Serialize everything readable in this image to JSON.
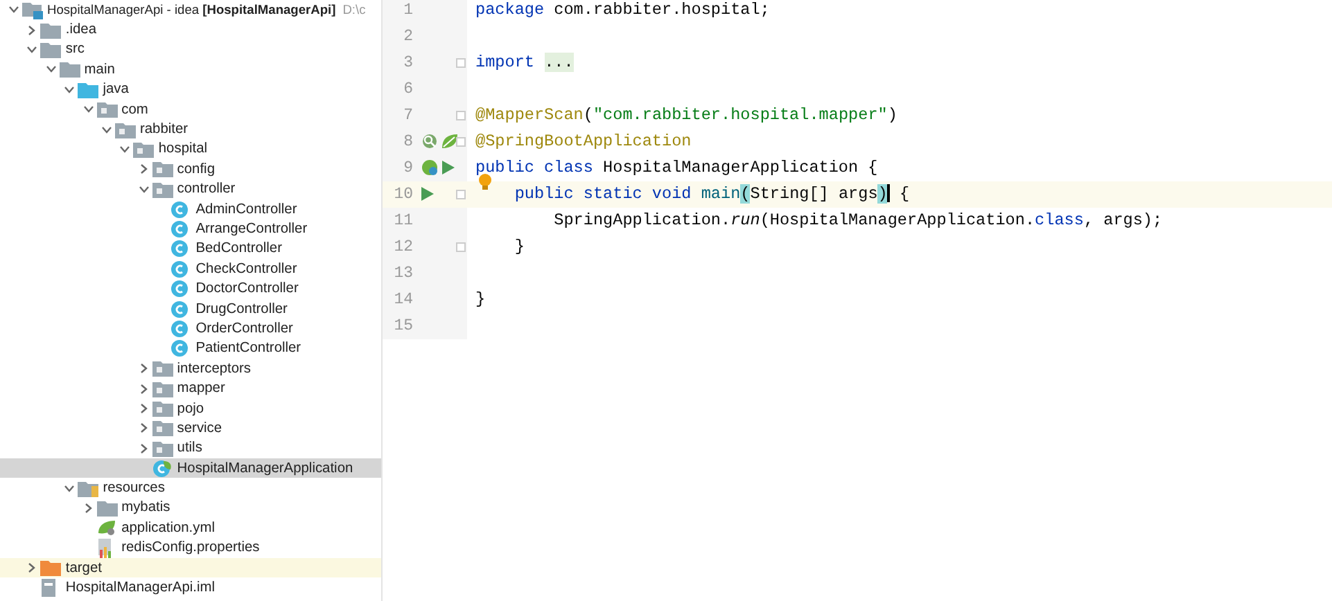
{
  "project_tree": {
    "items": [
      {
        "label": "HospitalManagerApi - idea **[HospitalManagerApi]**",
        "path": "D:\\c",
        "kind": "module",
        "expanded": true,
        "selected": false,
        "children": [
          {
            "label": ".idea",
            "kind": "folder",
            "expanded": false,
            "selected": false
          },
          {
            "label": "src",
            "kind": "folder",
            "expanded": true,
            "selected": false,
            "children": [
              {
                "label": "main",
                "kind": "folder",
                "expanded": true,
                "selected": false,
                "children": [
                  {
                    "label": "java",
                    "kind": "source-folder",
                    "expanded": true,
                    "selected": false,
                    "children": [
                      {
                        "label": "com",
                        "kind": "package",
                        "expanded": true,
                        "selected": false,
                        "children": [
                          {
                            "label": "rabbiter",
                            "kind": "package",
                            "expanded": true,
                            "selected": false,
                            "children": [
                              {
                                "label": "hospital",
                                "kind": "package",
                                "expanded": true,
                                "selected": false,
                                "children": [
                                  {
                                    "label": "config",
                                    "kind": "package",
                                    "expanded": false,
                                    "selected": false
                                  },
                                  {
                                    "label": "controller",
                                    "kind": "package",
                                    "expanded": true,
                                    "selected": false,
                                    "children": [
                                      {
                                        "label": "AdminController",
                                        "kind": "class",
                                        "selected": false
                                      },
                                      {
                                        "label": "ArrangeController",
                                        "kind": "class",
                                        "selected": false
                                      },
                                      {
                                        "label": "BedController",
                                        "kind": "class",
                                        "selected": false
                                      },
                                      {
                                        "label": "CheckController",
                                        "kind": "class",
                                        "selected": false
                                      },
                                      {
                                        "label": "DoctorController",
                                        "kind": "class",
                                        "selected": false
                                      },
                                      {
                                        "label": "DrugController",
                                        "kind": "class",
                                        "selected": false
                                      },
                                      {
                                        "label": "OrderController",
                                        "kind": "class",
                                        "selected": false
                                      },
                                      {
                                        "label": "PatientController",
                                        "kind": "class",
                                        "selected": false
                                      }
                                    ]
                                  },
                                  {
                                    "label": "interceptors",
                                    "kind": "package",
                                    "expanded": false,
                                    "selected": false
                                  },
                                  {
                                    "label": "mapper",
                                    "kind": "package",
                                    "expanded": false,
                                    "selected": false
                                  },
                                  {
                                    "label": "pojo",
                                    "kind": "package",
                                    "expanded": false,
                                    "selected": false
                                  },
                                  {
                                    "label": "service",
                                    "kind": "package",
                                    "expanded": false,
                                    "selected": false
                                  },
                                  {
                                    "label": "utils",
                                    "kind": "package",
                                    "expanded": false,
                                    "selected": false
                                  },
                                  {
                                    "label": "HospitalManagerApplication",
                                    "kind": "app-class",
                                    "selected": true
                                  }
                                ]
                              }
                            ]
                          }
                        ]
                      }
                    ]
                  },
                  {
                    "label": "resources",
                    "kind": "resource-folder",
                    "expanded": true,
                    "selected": false,
                    "children": [
                      {
                        "label": "mybatis",
                        "kind": "folder",
                        "expanded": false,
                        "selected": false
                      },
                      {
                        "label": "application.yml",
                        "kind": "yml",
                        "selected": false
                      },
                      {
                        "label": "redisConfig.properties",
                        "kind": "properties",
                        "selected": false
                      }
                    ]
                  }
                ]
              }
            ]
          },
          {
            "label": "target",
            "kind": "excluded-folder",
            "expanded": false,
            "selected": false
          },
          {
            "label": "HospitalManagerApi.iml",
            "kind": "iml",
            "selected": false
          }
        ]
      }
    ]
  },
  "editor": {
    "lines": [
      {
        "number": "1",
        "tokens": [
          {
            "text": "package",
            "kind": "kw"
          },
          {
            "text": " com.rabbiter.hospital;",
            "kind": "plain"
          }
        ]
      },
      {
        "number": "2"
      },
      {
        "number": "3",
        "fold": true,
        "tokens": [
          {
            "text": "import ",
            "kind": "kw"
          },
          {
            "text": "...",
            "kind": "folded"
          }
        ]
      },
      {
        "number": "6"
      },
      {
        "number": "7",
        "fold": true,
        "tokens": [
          {
            "text": "@MapperScan",
            "kind": "ann"
          },
          {
            "text": "(",
            "kind": "plain"
          },
          {
            "text": "\"com.rabbiter.hospital.mapper\"",
            "kind": "str"
          },
          {
            "text": ")",
            "kind": "plain"
          }
        ]
      },
      {
        "number": "8",
        "fold": true,
        "icons": [
          {
            "kind": "bean-search"
          },
          {
            "kind": "spring"
          }
        ],
        "tokens": [
          {
            "text": "@SpringBootApplication",
            "kind": "ann"
          }
        ]
      },
      {
        "number": "9",
        "icons": [
          {
            "kind": "bean"
          },
          {
            "kind": "run"
          }
        ],
        "tokens": [
          {
            "text": "public class",
            "kind": "kw"
          },
          {
            "text": " HospitalManagerApplication {",
            "kind": "plain"
          }
        ]
      },
      {
        "number": "10",
        "current": true,
        "fold": true,
        "bulb": true,
        "icons": [
          {
            "kind": "run"
          }
        ],
        "tokens": [
          {
            "text": "    public static void ",
            "kind": "kw"
          },
          {
            "text": "main",
            "kind": "method"
          },
          {
            "text": "(",
            "kind": "match"
          },
          {
            "text": "String[] args",
            "kind": "plain"
          },
          {
            "text": ")",
            "kind": "match",
            "caret": true
          },
          {
            "text": " {",
            "kind": "plain"
          }
        ]
      },
      {
        "number": "11",
        "tokens": [
          {
            "text": "        SpringApplication.",
            "kind": "plain"
          },
          {
            "text": "run",
            "kind": "ital"
          },
          {
            "text": "(HospitalManagerApplication.",
            "kind": "plain"
          },
          {
            "text": "class",
            "kind": "kw"
          },
          {
            "text": ", args);",
            "kind": "plain"
          }
        ]
      },
      {
        "number": "12",
        "fold": true,
        "tokens": [
          {
            "text": "    }",
            "kind": "plain"
          }
        ]
      },
      {
        "number": "13"
      },
      {
        "number": "14",
        "tokens": [
          {
            "text": "}",
            "kind": "plain"
          }
        ]
      },
      {
        "number": "15"
      }
    ]
  }
}
